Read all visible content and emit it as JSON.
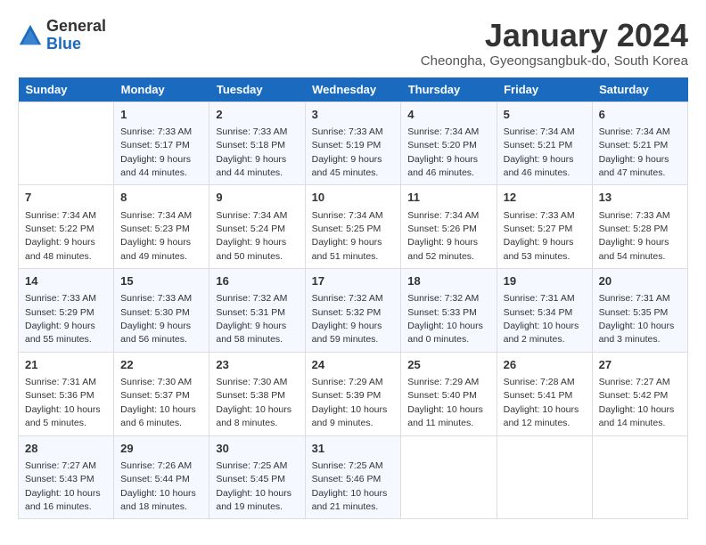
{
  "header": {
    "logo": {
      "general": "General",
      "blue": "Blue"
    },
    "title": "January 2024",
    "subtitle": "Cheongha, Gyeongsangbuk-do, South Korea"
  },
  "days_of_week": [
    "Sunday",
    "Monday",
    "Tuesday",
    "Wednesday",
    "Thursday",
    "Friday",
    "Saturday"
  ],
  "weeks": [
    [
      {
        "day": "",
        "info": ""
      },
      {
        "day": "1",
        "info": "Sunrise: 7:33 AM\nSunset: 5:17 PM\nDaylight: 9 hours\nand 44 minutes."
      },
      {
        "day": "2",
        "info": "Sunrise: 7:33 AM\nSunset: 5:18 PM\nDaylight: 9 hours\nand 44 minutes."
      },
      {
        "day": "3",
        "info": "Sunrise: 7:33 AM\nSunset: 5:19 PM\nDaylight: 9 hours\nand 45 minutes."
      },
      {
        "day": "4",
        "info": "Sunrise: 7:34 AM\nSunset: 5:20 PM\nDaylight: 9 hours\nand 46 minutes."
      },
      {
        "day": "5",
        "info": "Sunrise: 7:34 AM\nSunset: 5:21 PM\nDaylight: 9 hours\nand 46 minutes."
      },
      {
        "day": "6",
        "info": "Sunrise: 7:34 AM\nSunset: 5:21 PM\nDaylight: 9 hours\nand 47 minutes."
      }
    ],
    [
      {
        "day": "7",
        "info": "Sunrise: 7:34 AM\nSunset: 5:22 PM\nDaylight: 9 hours\nand 48 minutes."
      },
      {
        "day": "8",
        "info": "Sunrise: 7:34 AM\nSunset: 5:23 PM\nDaylight: 9 hours\nand 49 minutes."
      },
      {
        "day": "9",
        "info": "Sunrise: 7:34 AM\nSunset: 5:24 PM\nDaylight: 9 hours\nand 50 minutes."
      },
      {
        "day": "10",
        "info": "Sunrise: 7:34 AM\nSunset: 5:25 PM\nDaylight: 9 hours\nand 51 minutes."
      },
      {
        "day": "11",
        "info": "Sunrise: 7:34 AM\nSunset: 5:26 PM\nDaylight: 9 hours\nand 52 minutes."
      },
      {
        "day": "12",
        "info": "Sunrise: 7:33 AM\nSunset: 5:27 PM\nDaylight: 9 hours\nand 53 minutes."
      },
      {
        "day": "13",
        "info": "Sunrise: 7:33 AM\nSunset: 5:28 PM\nDaylight: 9 hours\nand 54 minutes."
      }
    ],
    [
      {
        "day": "14",
        "info": "Sunrise: 7:33 AM\nSunset: 5:29 PM\nDaylight: 9 hours\nand 55 minutes."
      },
      {
        "day": "15",
        "info": "Sunrise: 7:33 AM\nSunset: 5:30 PM\nDaylight: 9 hours\nand 56 minutes."
      },
      {
        "day": "16",
        "info": "Sunrise: 7:32 AM\nSunset: 5:31 PM\nDaylight: 9 hours\nand 58 minutes."
      },
      {
        "day": "17",
        "info": "Sunrise: 7:32 AM\nSunset: 5:32 PM\nDaylight: 9 hours\nand 59 minutes."
      },
      {
        "day": "18",
        "info": "Sunrise: 7:32 AM\nSunset: 5:33 PM\nDaylight: 10 hours\nand 0 minutes."
      },
      {
        "day": "19",
        "info": "Sunrise: 7:31 AM\nSunset: 5:34 PM\nDaylight: 10 hours\nand 2 minutes."
      },
      {
        "day": "20",
        "info": "Sunrise: 7:31 AM\nSunset: 5:35 PM\nDaylight: 10 hours\nand 3 minutes."
      }
    ],
    [
      {
        "day": "21",
        "info": "Sunrise: 7:31 AM\nSunset: 5:36 PM\nDaylight: 10 hours\nand 5 minutes."
      },
      {
        "day": "22",
        "info": "Sunrise: 7:30 AM\nSunset: 5:37 PM\nDaylight: 10 hours\nand 6 minutes."
      },
      {
        "day": "23",
        "info": "Sunrise: 7:30 AM\nSunset: 5:38 PM\nDaylight: 10 hours\nand 8 minutes."
      },
      {
        "day": "24",
        "info": "Sunrise: 7:29 AM\nSunset: 5:39 PM\nDaylight: 10 hours\nand 9 minutes."
      },
      {
        "day": "25",
        "info": "Sunrise: 7:29 AM\nSunset: 5:40 PM\nDaylight: 10 hours\nand 11 minutes."
      },
      {
        "day": "26",
        "info": "Sunrise: 7:28 AM\nSunset: 5:41 PM\nDaylight: 10 hours\nand 12 minutes."
      },
      {
        "day": "27",
        "info": "Sunrise: 7:27 AM\nSunset: 5:42 PM\nDaylight: 10 hours\nand 14 minutes."
      }
    ],
    [
      {
        "day": "28",
        "info": "Sunrise: 7:27 AM\nSunset: 5:43 PM\nDaylight: 10 hours\nand 16 minutes."
      },
      {
        "day": "29",
        "info": "Sunrise: 7:26 AM\nSunset: 5:44 PM\nDaylight: 10 hours\nand 18 minutes."
      },
      {
        "day": "30",
        "info": "Sunrise: 7:25 AM\nSunset: 5:45 PM\nDaylight: 10 hours\nand 19 minutes."
      },
      {
        "day": "31",
        "info": "Sunrise: 7:25 AM\nSunset: 5:46 PM\nDaylight: 10 hours\nand 21 minutes."
      },
      {
        "day": "",
        "info": ""
      },
      {
        "day": "",
        "info": ""
      },
      {
        "day": "",
        "info": ""
      }
    ]
  ]
}
